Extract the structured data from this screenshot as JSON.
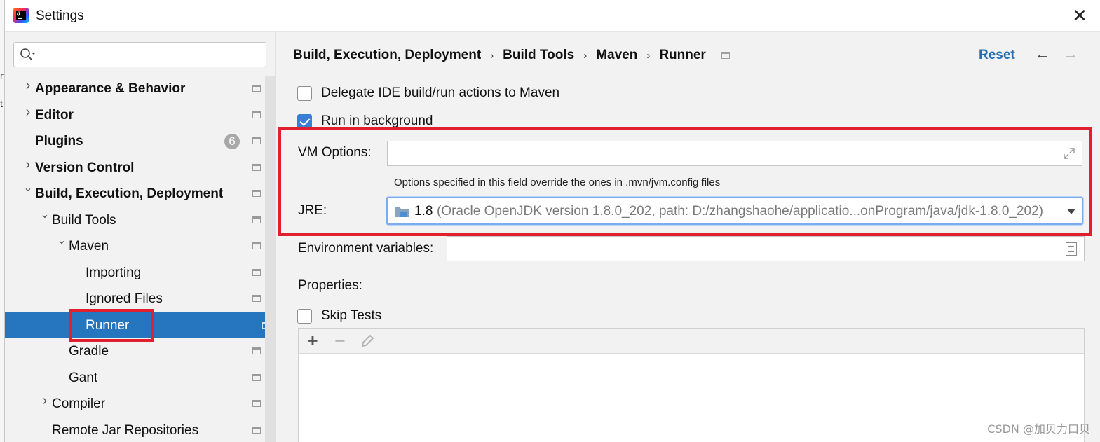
{
  "window": {
    "title": "Settings"
  },
  "sidebar": {
    "search": {
      "placeholder": ""
    },
    "items": [
      {
        "label": "Appearance & Behavior",
        "level": 0,
        "bold": true,
        "expandable": true,
        "expanded": false
      },
      {
        "label": "Editor",
        "level": 0,
        "bold": true,
        "expandable": true,
        "expanded": false
      },
      {
        "label": "Plugins",
        "level": 0,
        "bold": true,
        "expandable": false,
        "badge": "6"
      },
      {
        "label": "Version Control",
        "level": 0,
        "bold": true,
        "expandable": true,
        "expanded": false
      },
      {
        "label": "Build, Execution, Deployment",
        "level": 0,
        "bold": true,
        "expandable": true,
        "expanded": true
      },
      {
        "label": "Build Tools",
        "level": 1,
        "bold": false,
        "expandable": true,
        "expanded": true
      },
      {
        "label": "Maven",
        "level": 2,
        "bold": false,
        "expandable": true,
        "expanded": true
      },
      {
        "label": "Importing",
        "level": 3,
        "bold": false,
        "expandable": false
      },
      {
        "label": "Ignored Files",
        "level": 3,
        "bold": false,
        "expandable": false
      },
      {
        "label": "Runner",
        "level": 3,
        "bold": false,
        "expandable": false,
        "selected": true
      },
      {
        "label": "Gradle",
        "level": 2,
        "bold": false,
        "expandable": false
      },
      {
        "label": "Gant",
        "level": 2,
        "bold": false,
        "expandable": false
      },
      {
        "label": "Compiler",
        "level": 1,
        "bold": false,
        "expandable": true,
        "expanded": false
      },
      {
        "label": "Remote Jar Repositories",
        "level": 1,
        "bold": false,
        "expandable": false
      }
    ]
  },
  "breadcrumb": [
    "Build, Execution, Deployment",
    "Build Tools",
    "Maven",
    "Runner"
  ],
  "header": {
    "reset_label": "Reset"
  },
  "form": {
    "delegate": {
      "label": "Delegate IDE build/run actions to Maven",
      "checked": false
    },
    "background": {
      "label": "Run in background",
      "checked": true
    },
    "vm_options": {
      "label": "VM Options:",
      "value": "",
      "hint": "Options specified in this field override the ones in .mvn/jvm.config files"
    },
    "jre": {
      "label": "JRE:",
      "version": "1.8",
      "detail": "(Oracle OpenJDK version 1.8.0_202, path: D:/zhangshaohe/applicatio...onProgram/java/jdk-1.8.0_202)"
    },
    "env": {
      "label": "Environment variables:",
      "value": ""
    },
    "properties": {
      "label": "Properties:"
    },
    "skip_tests": {
      "label": "Skip Tests",
      "checked": false
    }
  },
  "toolbar": {
    "add": "+",
    "remove": "−"
  },
  "watermark": "CSDN @加贝力口贝",
  "colors": {
    "selection": "#2675bf",
    "accent": "#2470b3",
    "highlight": "#e0202e"
  }
}
